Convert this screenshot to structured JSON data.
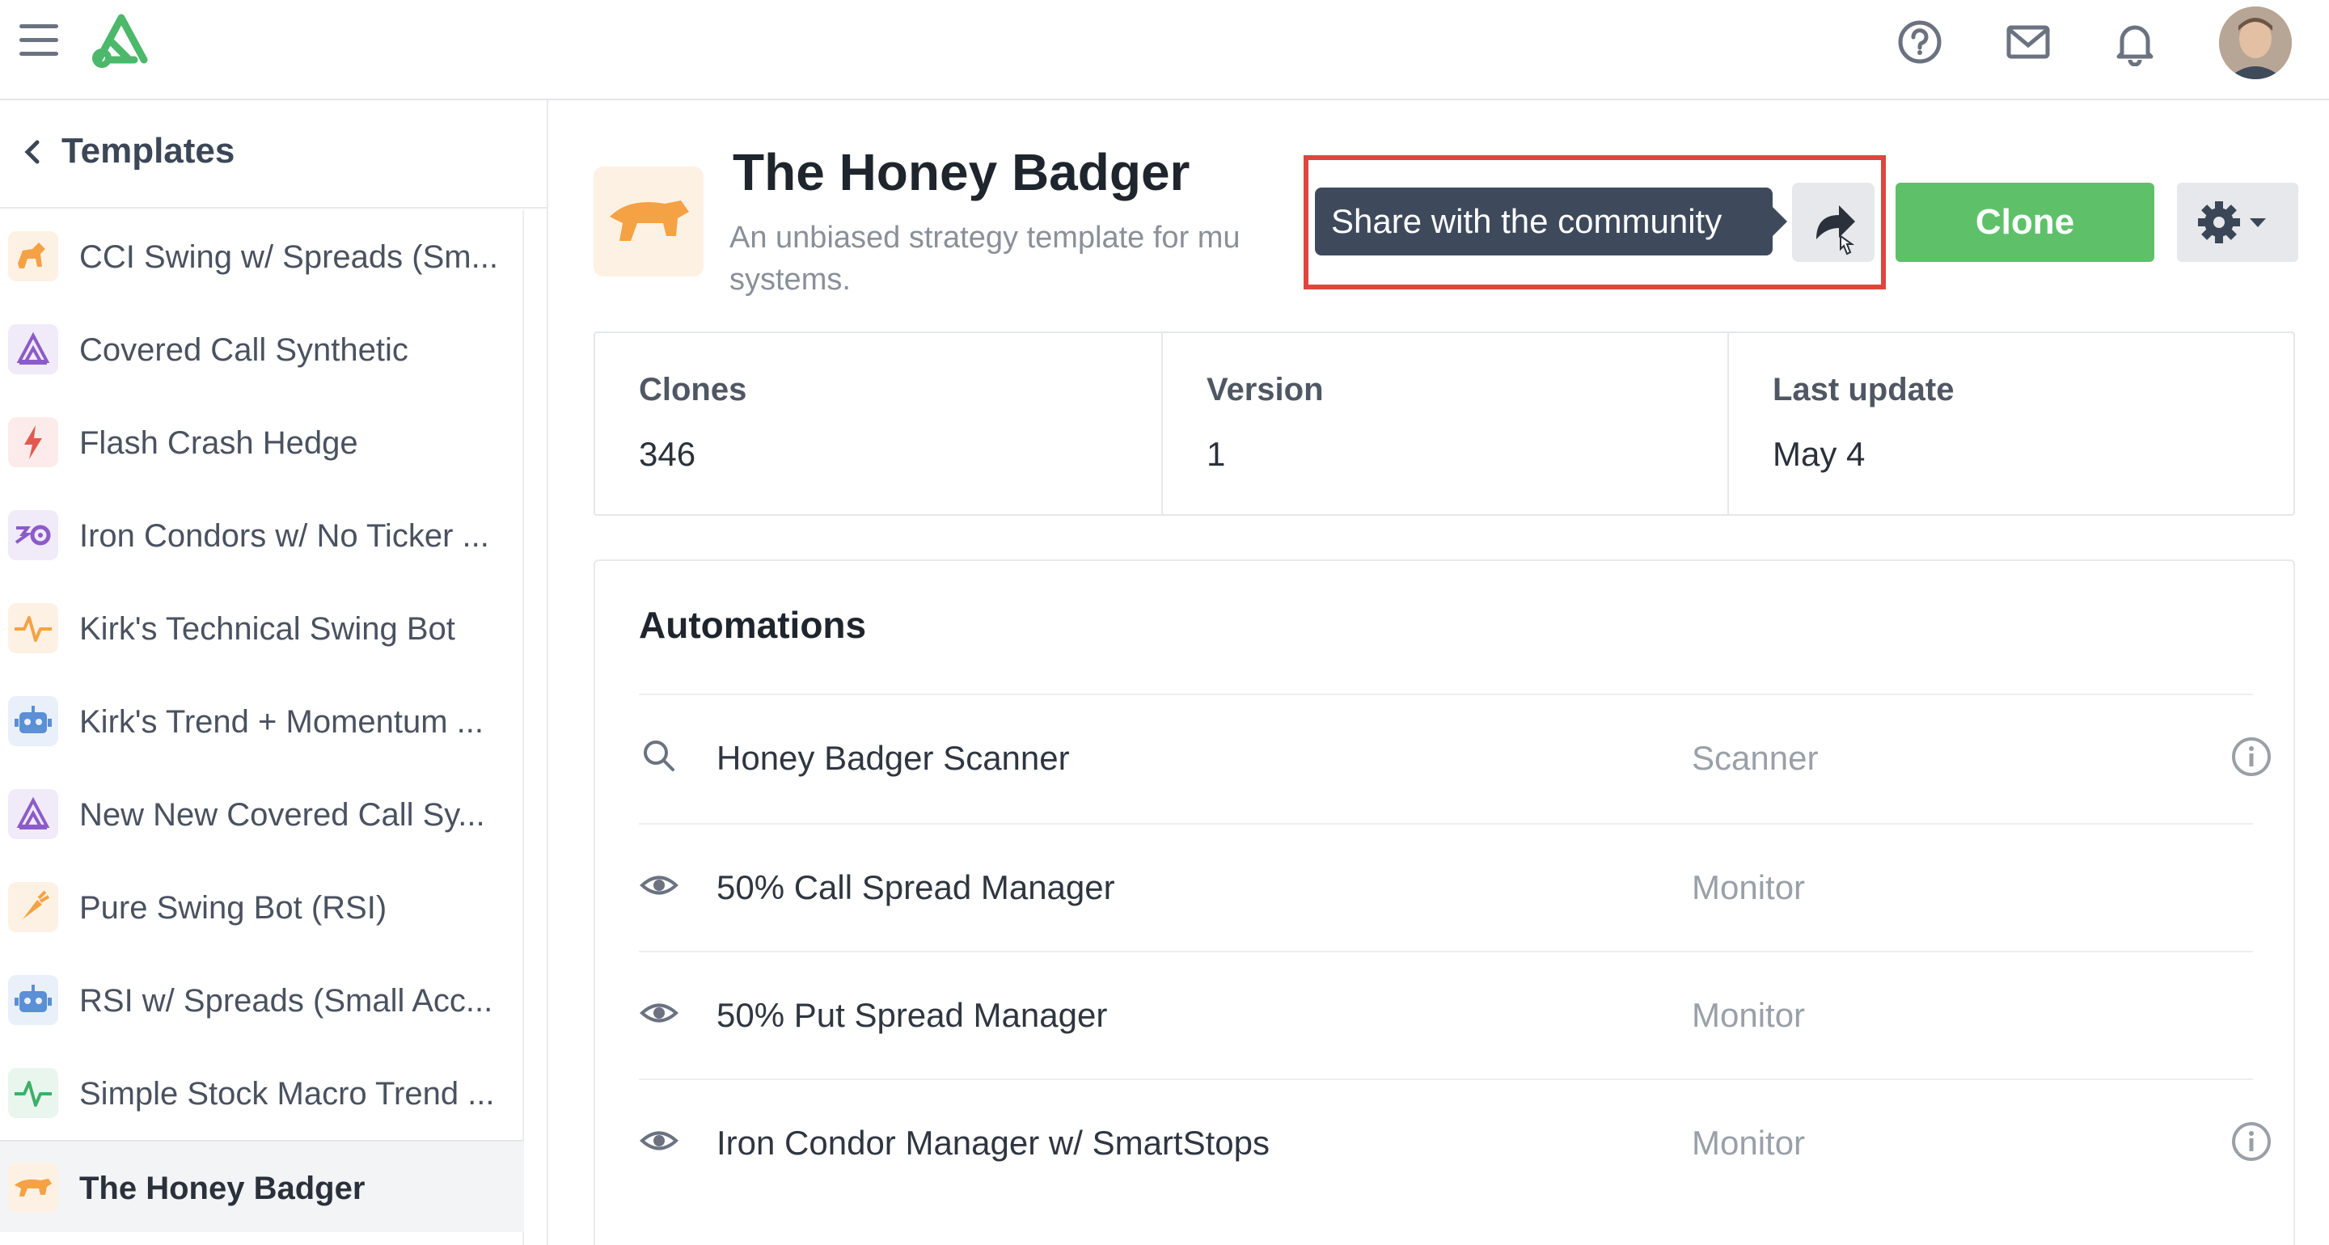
{
  "topbar": {
    "menu_icon": "hamburger-icon",
    "logo_icon": "app-logo",
    "help_icon": "help-circle-icon",
    "mail_icon": "mail-icon",
    "bell_icon": "bell-icon"
  },
  "sidebar": {
    "title": "Templates",
    "items": [
      {
        "label": "CCI Swing w/ Spreads (Sm...",
        "icon": "dog-icon",
        "color": "#f5a244",
        "bg": "#fdf1e4"
      },
      {
        "label": "Covered Call Synthetic",
        "icon": "mountain-icon",
        "color": "#8b5cc9",
        "bg": "#f1eaf8"
      },
      {
        "label": "Flash Crash Hedge",
        "icon": "bolt-icon",
        "color": "#e25a4f",
        "bg": "#fcebea"
      },
      {
        "label": "Iron Condors w/ No Ticker ...",
        "icon": "condor-icon",
        "color": "#8b5cc9",
        "bg": "#f1eaf8"
      },
      {
        "label": "Kirk's Technical Swing Bot",
        "icon": "pulse-icon",
        "color": "#f5a244",
        "bg": "#fdf1e4"
      },
      {
        "label": "Kirk's Trend + Momentum ...",
        "icon": "robot-icon",
        "color": "#5b8fd6",
        "bg": "#e9f0fa"
      },
      {
        "label": "New New Covered Call Sy...",
        "icon": "mountain-icon",
        "color": "#8b5cc9",
        "bg": "#f1eaf8"
      },
      {
        "label": "Pure Swing Bot (RSI)",
        "icon": "carrot-icon",
        "color": "#f5a244",
        "bg": "#fdf1e4"
      },
      {
        "label": "RSI w/ Spreads (Small Acc...",
        "icon": "robot-icon",
        "color": "#5b8fd6",
        "bg": "#e9f0fa"
      },
      {
        "label": "Simple Stock Macro Trend ...",
        "icon": "pulse-icon",
        "color": "#3fae6a",
        "bg": "#e8f6ee"
      },
      {
        "label": "The Honey Badger",
        "icon": "badger-icon",
        "color": "#f5a244",
        "bg": "#fdf1e4",
        "active": true
      }
    ]
  },
  "header": {
    "title": "The Honey Badger",
    "description": "An unbiased strategy template for mu systems.",
    "tooltip": "Share with the community",
    "share_icon": "share-arrow-icon",
    "clone_label": "Clone",
    "settings_icon": "gear-icon"
  },
  "stats": [
    {
      "label": "Clones",
      "value": "346"
    },
    {
      "label": "Version",
      "value": "1"
    },
    {
      "label": "Last update",
      "value": "May 4"
    }
  ],
  "automations": {
    "title": "Automations",
    "rows": [
      {
        "icon": "search-icon",
        "name": "Honey Badger Scanner",
        "type": "Scanner",
        "info": true
      },
      {
        "icon": "eye-icon",
        "name": "50% Call Spread Manager",
        "type": "Monitor",
        "info": false
      },
      {
        "icon": "eye-icon",
        "name": "50% Put Spread Manager",
        "type": "Monitor",
        "info": false
      },
      {
        "icon": "eye-icon",
        "name": "Iron Condor Manager w/ SmartStops",
        "type": "Monitor",
        "info": true
      }
    ]
  },
  "colors": {
    "accent_green": "#5ec16a",
    "highlight_red": "#e0453d",
    "tooltip_bg": "#3e4a5c"
  }
}
